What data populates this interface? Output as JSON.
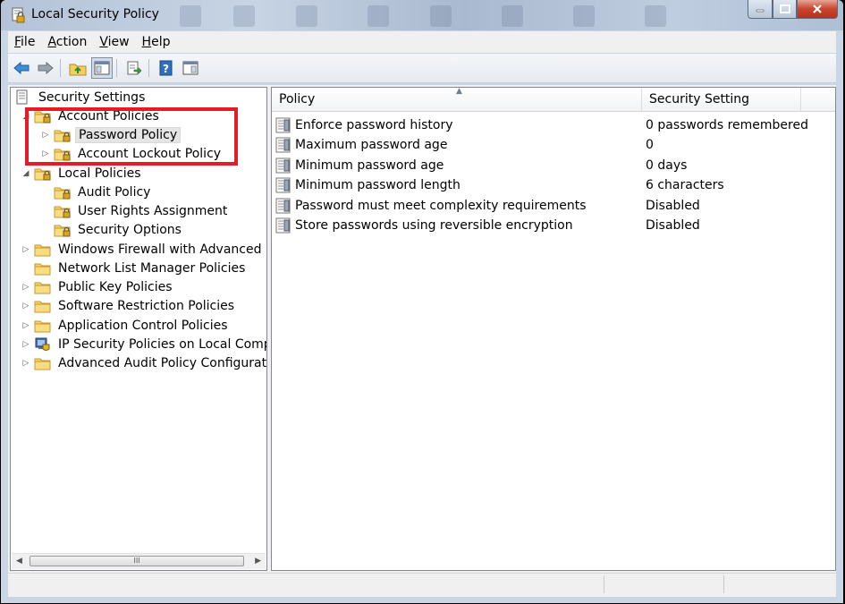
{
  "window": {
    "title": "Local Security Policy"
  },
  "menu": [
    {
      "label": "File",
      "key": "F",
      "rest": "ile"
    },
    {
      "label": "Action",
      "key": "A",
      "rest": "ction"
    },
    {
      "label": "View",
      "key": "V",
      "rest": "iew"
    },
    {
      "label": "Help",
      "key": "H",
      "rest": "elp"
    }
  ],
  "toolbar": {
    "buttons": [
      "back-icon",
      "forward-icon",
      "up-folder-icon",
      "show-hide-tree-icon",
      "export-list-icon",
      "help-icon",
      "action-pane-icon"
    ]
  },
  "tree": {
    "root": "Security Settings",
    "items": [
      {
        "label": "Account Policies",
        "icon": "lock-folder-icon",
        "expander": "expanded"
      },
      {
        "label": "Password Policy",
        "icon": "lock-folder-icon",
        "expander": "collapsed",
        "selected": true
      },
      {
        "label": "Account Lockout Policy",
        "icon": "lock-folder-icon",
        "expander": "collapsed"
      },
      {
        "label": "Local Policies",
        "icon": "lock-folder-icon",
        "expander": "expanded"
      },
      {
        "label": "Audit Policy",
        "icon": "lock-folder-icon",
        "expander": "none"
      },
      {
        "label": "User Rights Assignment",
        "icon": "lock-folder-icon",
        "expander": "none"
      },
      {
        "label": "Security Options",
        "icon": "lock-folder-icon",
        "expander": "none"
      },
      {
        "label": "Windows Firewall with Advanced Secu",
        "icon": "folder-icon",
        "expander": "collapsed"
      },
      {
        "label": "Network List Manager Policies",
        "icon": "folder-icon",
        "expander": "none"
      },
      {
        "label": "Public Key Policies",
        "icon": "folder-icon",
        "expander": "collapsed"
      },
      {
        "label": "Software Restriction Policies",
        "icon": "folder-icon",
        "expander": "collapsed"
      },
      {
        "label": "Application Control Policies",
        "icon": "folder-icon",
        "expander": "collapsed"
      },
      {
        "label": "IP Security Policies on Local Compute",
        "icon": "ip-security-icon",
        "expander": "collapsed"
      },
      {
        "label": "Advanced Audit Policy Configuration",
        "icon": "folder-icon",
        "expander": "collapsed"
      }
    ],
    "scroll_thumb": "III"
  },
  "list": {
    "columns": [
      "Policy",
      "Security Setting"
    ],
    "rows": [
      {
        "policy": "Enforce password history",
        "setting": "0 passwords remembered"
      },
      {
        "policy": "Maximum password age",
        "setting": "0"
      },
      {
        "policy": "Minimum password age",
        "setting": "0 days"
      },
      {
        "policy": "Minimum password length",
        "setting": "6 characters"
      },
      {
        "policy": "Password must meet complexity requirements",
        "setting": "Disabled"
      },
      {
        "policy": "Store passwords using reversible encryption",
        "setting": "Disabled"
      }
    ]
  },
  "colors": {
    "highlight_box": "#e41c2a",
    "close_button": "#c7452f"
  }
}
